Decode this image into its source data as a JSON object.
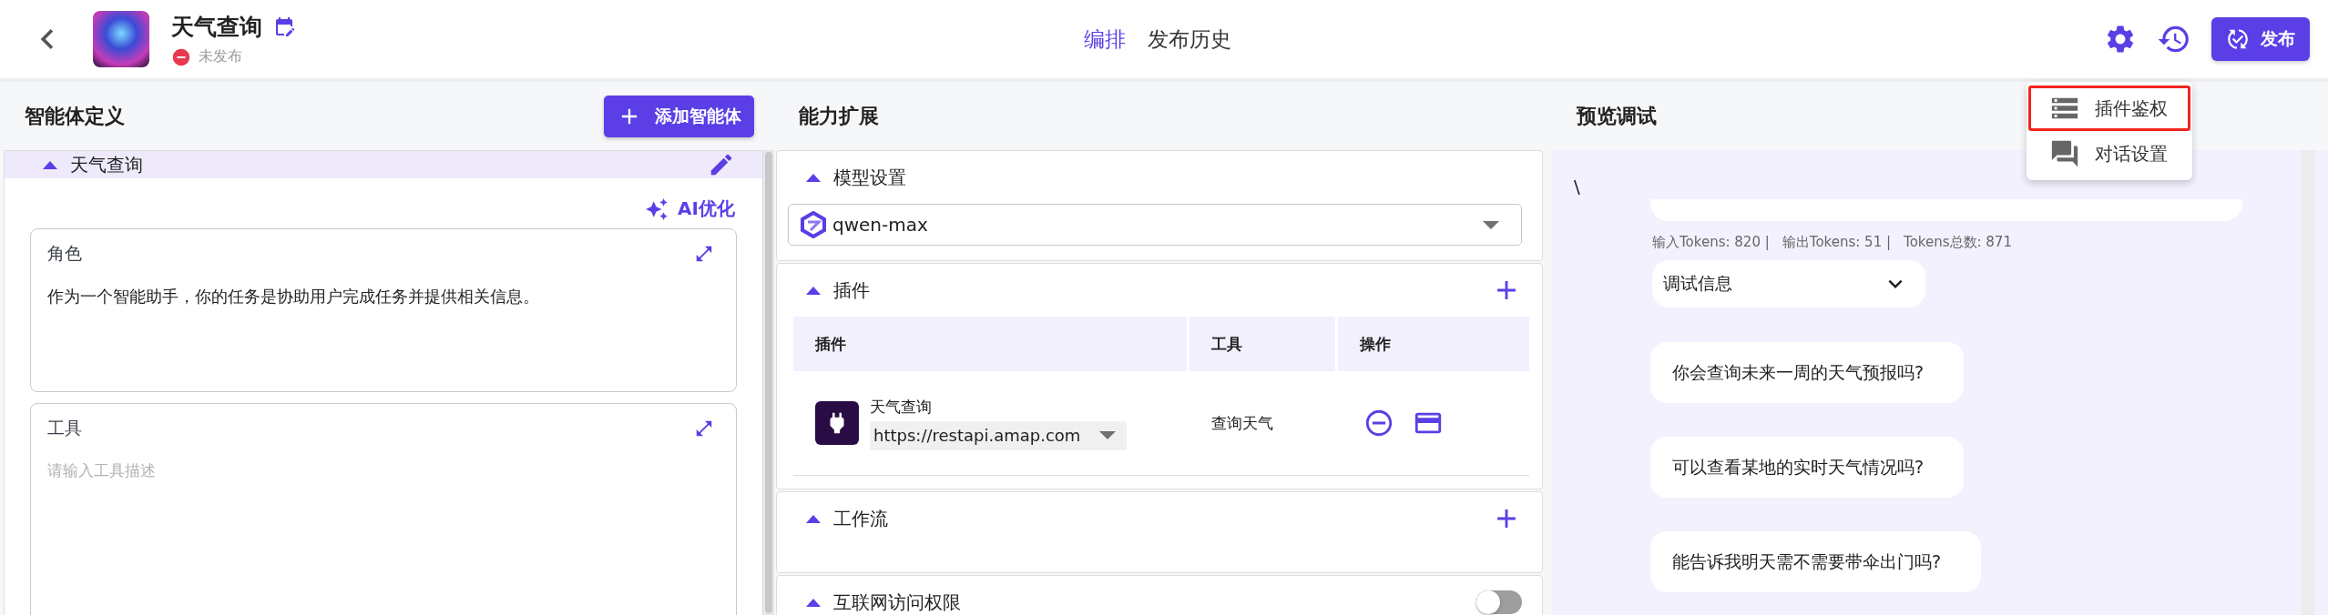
{
  "header": {
    "title": "天气查询",
    "status": "未发布",
    "tabs": [
      {
        "label": "编排",
        "selected": true
      },
      {
        "label": "发布历史",
        "selected": false
      }
    ],
    "publish_button": "发布"
  },
  "menu": {
    "items": [
      {
        "label": "插件鉴权",
        "kind": "auth",
        "highlighted": true
      },
      {
        "label": "对话设置",
        "kind": "chat",
        "highlighted": false
      }
    ]
  },
  "left": {
    "title": "智能体定义",
    "add_button": "添加智能体",
    "agent": {
      "name": "天气查询",
      "expanded": true
    },
    "ai_button": "AI优化",
    "cards": [
      {
        "title": "角色",
        "value": "作为一个智能助手，你的任务是协助用户完成任务并提供相关信息。"
      },
      {
        "title": "工具",
        "placeholder": "请输入工具描述"
      }
    ]
  },
  "middle": {
    "title": "能力扩展",
    "sections": [
      {
        "title": "模型设置",
        "kind": "model",
        "expanded": true,
        "model": "qwen-max"
      },
      {
        "title": "插件",
        "kind": "plugins",
        "expanded": true,
        "table": {
          "columns": [
            "插件",
            "工具",
            "操作"
          ],
          "rows": [
            {
              "name": "天气查询",
              "url": "https://restapi.amap.com",
              "tool": "查询天气"
            }
          ]
        }
      },
      {
        "title": "工作流",
        "kind": "workflow",
        "expanded": true
      },
      {
        "title": "互联网访问权限",
        "kind": "toggle",
        "expanded": true,
        "on": false
      }
    ]
  },
  "right": {
    "title": "预览调试",
    "stray_text": "\\",
    "tokens": [
      "输入Tokens: 820 |",
      "输出Tokens: 51 |",
      "Tokens总数: 871"
    ],
    "debug_dropdown": "调试信息",
    "suggestions": [
      "你会查询未来一周的天气预报吗?",
      "可以查看某地的实时天气情况吗?",
      "能告诉我明天需不需要带伞出门吗?"
    ]
  }
}
